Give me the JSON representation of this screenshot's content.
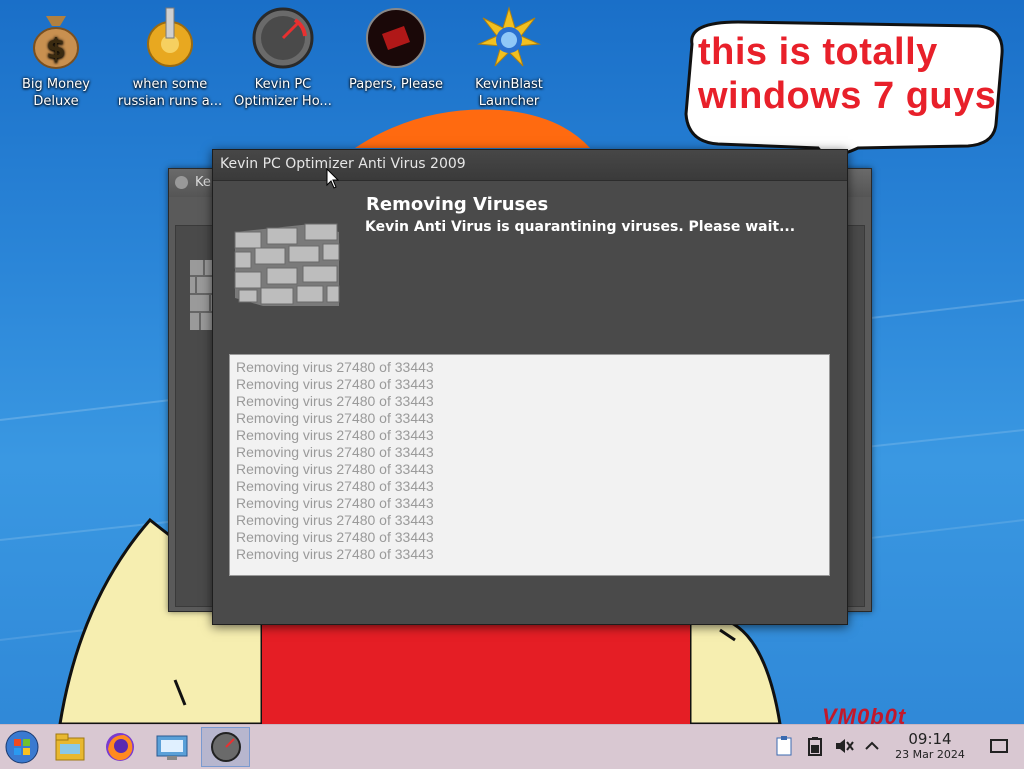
{
  "desktop": {
    "icons": [
      {
        "label_line1": "Big Money",
        "label_line2": "Deluxe",
        "icon": "money-bag-icon"
      },
      {
        "label_line1": "when some",
        "label_line2": "russian runs a...",
        "icon": "gear-icon"
      },
      {
        "label_line1": "Kevin PC",
        "label_line2": "Optimizer Ho...",
        "icon": "speedometer-icon"
      },
      {
        "label_line1": "Papers, Please",
        "label_line2": "",
        "icon": "papers-please-icon"
      },
      {
        "label_line1": "KevinBlast",
        "label_line2": "Launcher",
        "icon": "starburst-icon"
      }
    ],
    "speech_bubble": {
      "line1": "this is totally",
      "line2": "windows 7 guys"
    },
    "watermark": "VM0b0t"
  },
  "back_window": {
    "title": "Ke"
  },
  "window": {
    "title": "Kevin PC Optimizer Anti Virus 2009",
    "heading": "Removing Viruses",
    "subheading": "Kevin Anti Virus is quarantining viruses. Please wait...",
    "log_lines": [
      "Removing virus 27480 of 33443",
      "Removing virus 27480 of 33443",
      "Removing virus 27480 of 33443",
      "Removing virus 27480 of 33443",
      "Removing virus 27480 of 33443",
      "Removing virus 27480 of 33443",
      "Removing virus 27480 of 33443",
      "Removing virus 27480 of 33443",
      "Removing virus 27480 of 33443",
      "Removing virus 27480 of 33443",
      "Removing virus 27480 of 33443",
      "Removing virus 27480 of 33443"
    ]
  },
  "taskbar": {
    "buttons": [
      {
        "icon": "start-orb-icon"
      },
      {
        "icon": "file-manager-icon"
      },
      {
        "icon": "firefox-icon"
      },
      {
        "icon": "system-settings-icon"
      },
      {
        "icon": "kevin-optimizer-icon",
        "active": true
      }
    ],
    "tray": [
      "clipboard-icon",
      "battery-icon",
      "volume-muted-icon",
      "chevron-up-icon"
    ],
    "clock": {
      "time": "09:14",
      "date": "23 Mar 2024"
    }
  },
  "colors": {
    "speech_text": "#e8202a",
    "taskbar": "#d9c8d2",
    "window_bg": "#4a4a4a"
  }
}
